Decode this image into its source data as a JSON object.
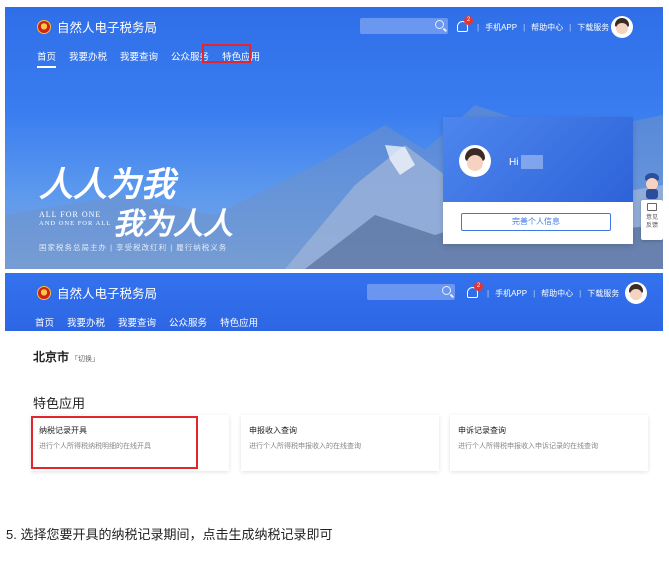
{
  "screen1": {
    "site_title": "自然人电子税务局",
    "nav": [
      "首页",
      "我要办税",
      "我要查询",
      "公众服务",
      "特色应用"
    ],
    "notification_count": "2",
    "top_links": [
      "手机APP",
      "帮助中心",
      "下载服务"
    ],
    "slogan_line1": "人人为我",
    "slogan_line2": "我为人人",
    "slogan_en1": "ALL FOR ONE",
    "slogan_en2": "AND ONE FOR ALL",
    "subline": "国家税务总局主办  |  享受税改红利  |  履行纳税义务",
    "user_card": {
      "greeting": "Hi",
      "button": "完善个人信息"
    },
    "side_widget": {
      "label_line1": "意见",
      "label_line2": "反馈"
    }
  },
  "screen2": {
    "site_title": "自然人电子税务局",
    "nav": [
      "首页",
      "我要办税",
      "我要查询",
      "公众服务",
      "特色应用"
    ],
    "notification_count": "2",
    "top_links": [
      "手机APP",
      "帮助中心",
      "下载服务"
    ],
    "city": "北京市",
    "switch_label": "「切换」",
    "section_title": "特色应用",
    "cards": [
      {
        "title": "纳税记录开具",
        "desc": "进行个人所得税纳税明细的在线开具"
      },
      {
        "title": "申报收入查询",
        "desc": "进行个人所得税申报收入的在线查询"
      },
      {
        "title": "申诉记录查询",
        "desc": "进行个人所得税申报收入申诉记录的在线查询"
      }
    ]
  },
  "caption": "5. 选择您要开具的纳税记录期间，点击生成纳税记录即可",
  "colors": {
    "brand_blue": "#2d66e4",
    "highlight_red": "#e3262b"
  }
}
